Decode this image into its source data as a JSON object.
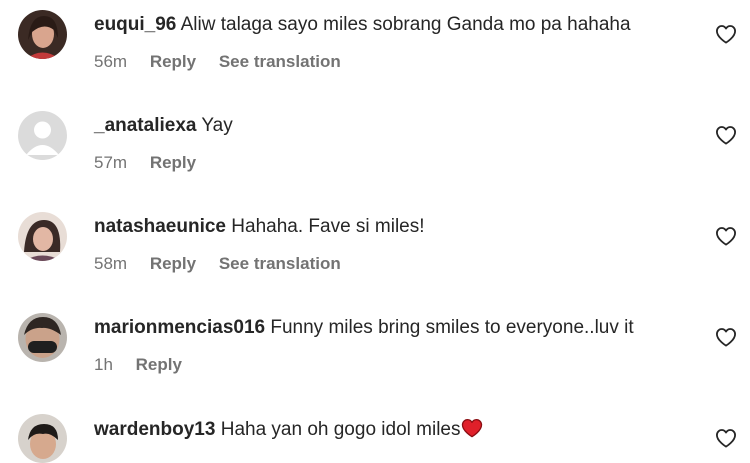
{
  "comments": [
    {
      "username": "euqui_96",
      "text": "Aliw talaga sayo miles sobrang Ganda mo pa hahaha",
      "time": "56m",
      "reply": "Reply",
      "translate": "See translation"
    },
    {
      "username": "_anataliexa",
      "text": "Yay",
      "time": "57m",
      "reply": "Reply"
    },
    {
      "username": "natashaeunice",
      "text": "Hahaha. Fave si miles!",
      "time": "58m",
      "reply": "Reply",
      "translate": "See translation"
    },
    {
      "username": "marionmencias016",
      "text": "Funny miles bring smiles to everyone..luv it",
      "time": "1h",
      "reply": "Reply"
    },
    {
      "username": "wardenboy13",
      "text": "Haha yan oh gogo idol miles",
      "emoji": "red-heart"
    }
  ],
  "icons": {
    "like": "heart-outline-icon"
  },
  "colors": {
    "text": "#262626",
    "meta": "#737373",
    "heart": "#e0202a"
  }
}
